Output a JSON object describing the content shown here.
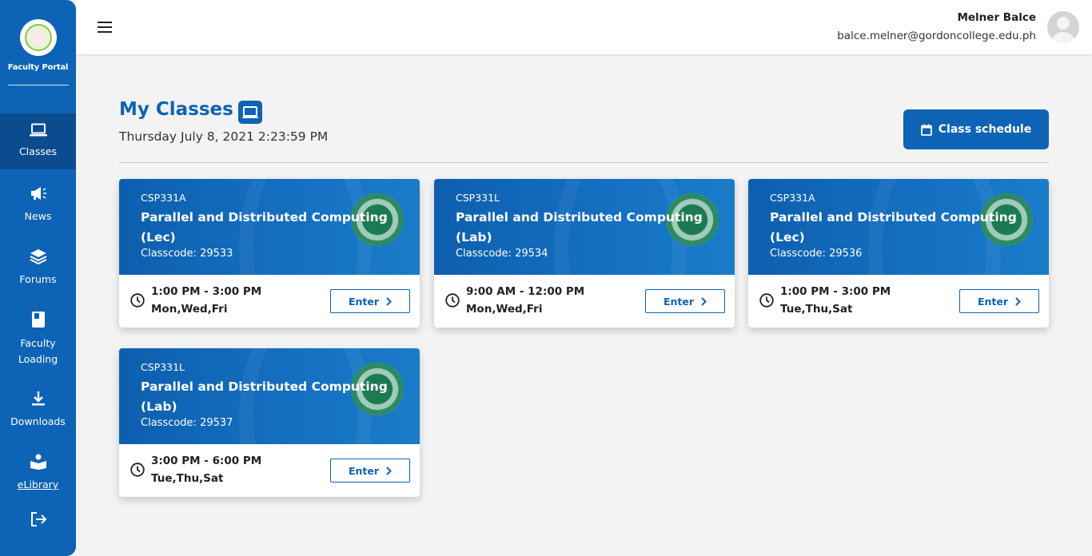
{
  "sidebar": {
    "brand_title": "Faculty Portal",
    "items": [
      {
        "label": "Classes",
        "icon": "laptop-icon",
        "active": true
      },
      {
        "label": "News",
        "icon": "megaphone-icon"
      },
      {
        "label": "Forums",
        "icon": "layers-icon"
      },
      {
        "label": "Faculty Loading",
        "icon": "book-icon"
      },
      {
        "label": "Downloads",
        "icon": "download-icon"
      },
      {
        "label": "eLibrary",
        "icon": "reader-icon"
      }
    ],
    "logout_icon": "logout-icon"
  },
  "header": {
    "user_name": "Melner Balce",
    "user_email": "balce.melner@gordoncollege.edu.ph"
  },
  "main": {
    "title": "My Classes",
    "datetime": "Thursday July 8, 2021 2:23:59 PM",
    "schedule_button": "Class schedule",
    "classes": [
      {
        "code": "CSP331A",
        "title": "Parallel and Distributed Computing",
        "type": "(Lec)",
        "classcode": "Classcode: 29533",
        "time": "1:00 PM - 3:00 PM",
        "days": "Mon,Wed,Fri",
        "enter": "Enter"
      },
      {
        "code": "CSP331L",
        "title": "Parallel and Distributed Computing",
        "type": "(Lab)",
        "classcode": "Classcode: 29534",
        "time": "9:00 AM - 12:00 PM",
        "days": "Mon,Wed,Fri",
        "enter": "Enter"
      },
      {
        "code": "CSP331A",
        "title": "Parallel and Distributed Computing",
        "type": "(Lec)",
        "classcode": "Classcode: 29536",
        "time": "1:00 PM - 3:00 PM",
        "days": "Tue,Thu,Sat",
        "enter": "Enter"
      },
      {
        "code": "CSP331L",
        "title": "Parallel and Distributed Computing",
        "type": "(Lab)",
        "classcode": "Classcode: 29537",
        "time": "3:00 PM - 6:00 PM",
        "days": "Tue,Thu,Sat",
        "enter": "Enter"
      }
    ]
  },
  "colors": {
    "primary": "#0d63b5",
    "sidebar_active": "#0a4c8e",
    "background": "#f3f3f3"
  }
}
